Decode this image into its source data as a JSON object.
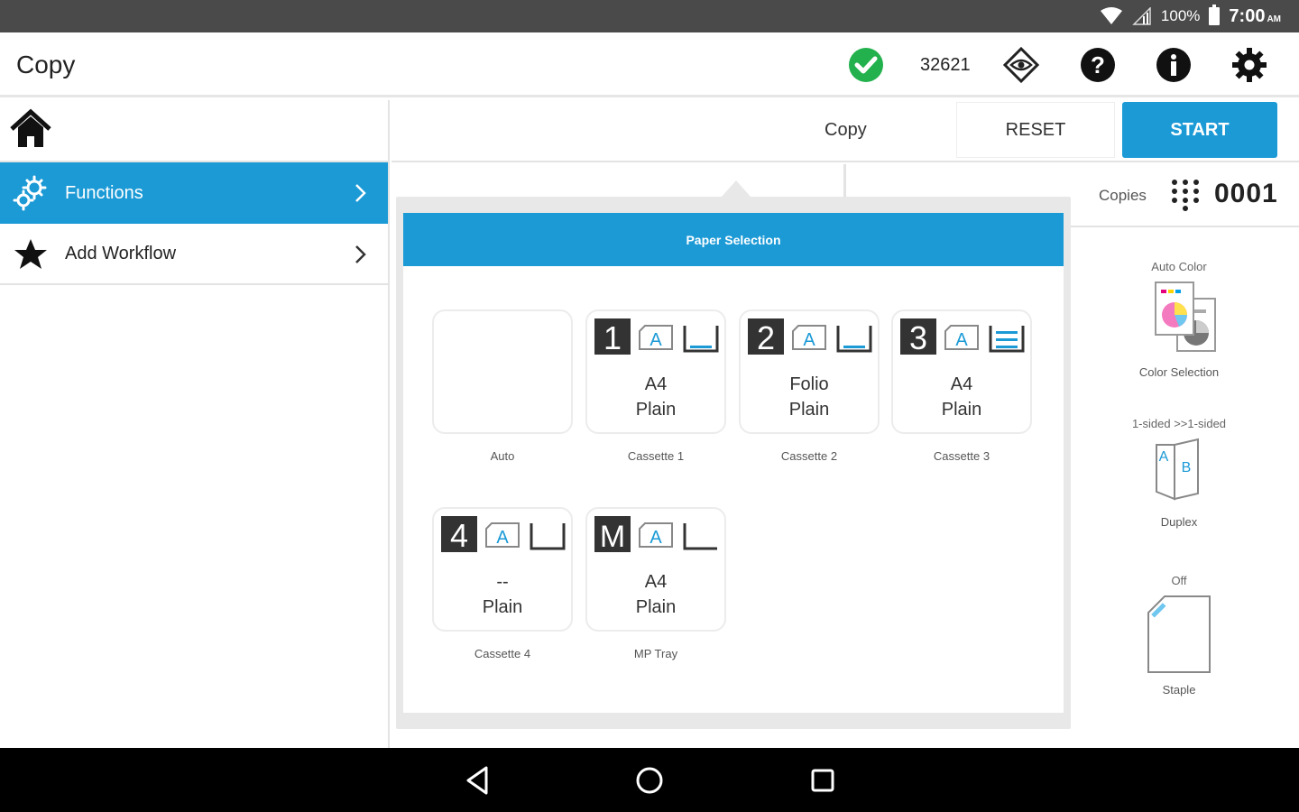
{
  "status_bar": {
    "battery": "100%",
    "time": "7:00",
    "ampm": "AM",
    "icons": [
      "wifi-icon",
      "signal-icon",
      "battery-icon"
    ]
  },
  "app_bar": {
    "title": "Copy",
    "counter": "32621",
    "icons": [
      "status-ok-icon",
      "eye-icon",
      "help-icon",
      "info-icon",
      "gear-icon"
    ],
    "accent_color": "#1b9ad6",
    "ok_color": "#22b14c"
  },
  "sidebar": {
    "items": [
      {
        "label": "Functions",
        "icon": "gears-icon",
        "active": true
      },
      {
        "label": "Add Workflow",
        "icon": "star-icon",
        "active": false
      }
    ]
  },
  "action_bar": {
    "mode_label": "Copy",
    "reset_label": "RESET",
    "start_label": "START"
  },
  "copies": {
    "label": "Copies",
    "value": "0001"
  },
  "features": [
    {
      "top": "Auto Color",
      "bottom": "Color Selection",
      "icon": "color-selection-icon"
    },
    {
      "top": "1-sided >>1-sided",
      "bottom": "Duplex",
      "icon": "duplex-icon"
    },
    {
      "top": "Off",
      "bottom": "Staple",
      "icon": "staple-icon"
    }
  ],
  "paper_selection": {
    "title": "Paper Selection",
    "sources": [
      {
        "badge": "",
        "size": "",
        "type": "",
        "caption": "Auto",
        "tray": "none"
      },
      {
        "badge": "1",
        "size": "A4",
        "type": "Plain",
        "caption": "Cassette 1",
        "tray": "low"
      },
      {
        "badge": "2",
        "size": "Folio",
        "type": "Plain",
        "caption": "Cassette 2",
        "tray": "low"
      },
      {
        "badge": "3",
        "size": "A4",
        "type": "Plain",
        "caption": "Cassette 3",
        "tray": "full"
      },
      {
        "badge": "4",
        "size": "--",
        "type": "Plain",
        "caption": "Cassette 4",
        "tray": "empty"
      },
      {
        "badge": "M",
        "size": "A4",
        "type": "Plain",
        "caption": "MP Tray",
        "tray": "mp"
      }
    ]
  },
  "nav_bar": {
    "icons": [
      "back-icon",
      "home-nav-icon",
      "recents-icon"
    ]
  }
}
